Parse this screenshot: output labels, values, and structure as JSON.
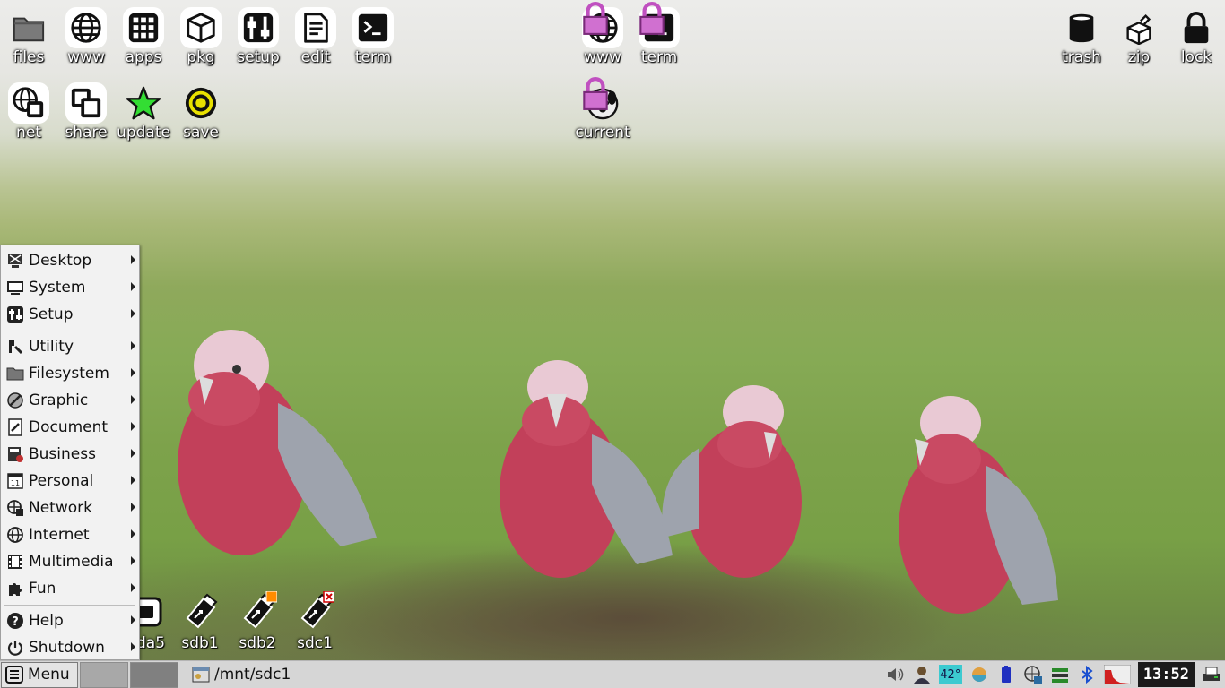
{
  "desktop_icons_top_left": [
    {
      "label": "files",
      "icon": "folder-icon"
    },
    {
      "label": "www",
      "icon": "globe-icon"
    },
    {
      "label": "apps",
      "icon": "apps-grid-icon"
    },
    {
      "label": "pkg",
      "icon": "package-box-icon"
    },
    {
      "label": "setup",
      "icon": "sliders-icon"
    },
    {
      "label": "edit",
      "icon": "document-edit-icon"
    },
    {
      "label": "term",
      "icon": "terminal-icon"
    }
  ],
  "desktop_icons_second_row": [
    {
      "label": "net",
      "icon": "network-globe-icon"
    },
    {
      "label": "share",
      "icon": "share-windows-icon"
    },
    {
      "label": "update",
      "icon": "star-icon"
    },
    {
      "label": "save",
      "icon": "target-icon"
    }
  ],
  "desktop_icons_center": [
    {
      "label": "www",
      "icon": "locked-globe-icon"
    },
    {
      "label": "term",
      "icon": "locked-terminal-icon"
    },
    {
      "label": "current",
      "icon": "locked-puppy-icon"
    }
  ],
  "desktop_icons_top_right": [
    {
      "label": "trash",
      "icon": "trash-bin-icon"
    },
    {
      "label": "zip",
      "icon": "zip-box-icon"
    },
    {
      "label": "lock",
      "icon": "padlock-icon"
    }
  ],
  "drives": [
    {
      "label": "da5",
      "icon": "drive-icon"
    },
    {
      "label": "sdb1",
      "icon": "usb-drive-icon"
    },
    {
      "label": "sdb2",
      "icon": "usb-drive-icon",
      "badge": "orange"
    },
    {
      "label": "sdc1",
      "icon": "usb-drive-icon",
      "badge": "x"
    }
  ],
  "menu": {
    "groups": [
      [
        {
          "label": "Desktop",
          "icon": "desktop-icon"
        },
        {
          "label": "System",
          "icon": "monitor-icon"
        },
        {
          "label": "Setup",
          "icon": "setup-icon"
        }
      ],
      [
        {
          "label": "Utility",
          "icon": "utility-icon"
        },
        {
          "label": "Filesystem",
          "icon": "folder-icon"
        },
        {
          "label": "Graphic",
          "icon": "graphic-icon"
        },
        {
          "label": "Document",
          "icon": "document-icon"
        },
        {
          "label": "Business",
          "icon": "business-icon"
        },
        {
          "label": "Personal",
          "icon": "calendar-icon"
        },
        {
          "label": "Network",
          "icon": "network-icon"
        },
        {
          "label": "Internet",
          "icon": "globe-icon"
        },
        {
          "label": "Multimedia",
          "icon": "film-icon"
        },
        {
          "label": "Fun",
          "icon": "puzzle-icon"
        }
      ],
      [
        {
          "label": "Help",
          "icon": "help-icon"
        },
        {
          "label": "Shutdown",
          "icon": "power-icon"
        }
      ]
    ]
  },
  "taskbar": {
    "menu_label": "Menu",
    "task_label": "/mnt/sdc1",
    "temperature": "42°",
    "clock": "13:52"
  },
  "colors": {
    "taskbar_bg": "#d6d6d6",
    "menu_bg": "#f2f2f2",
    "temp_bg": "#3ccad0",
    "update_star": "#33dd33",
    "save_target": "#e8e000"
  }
}
